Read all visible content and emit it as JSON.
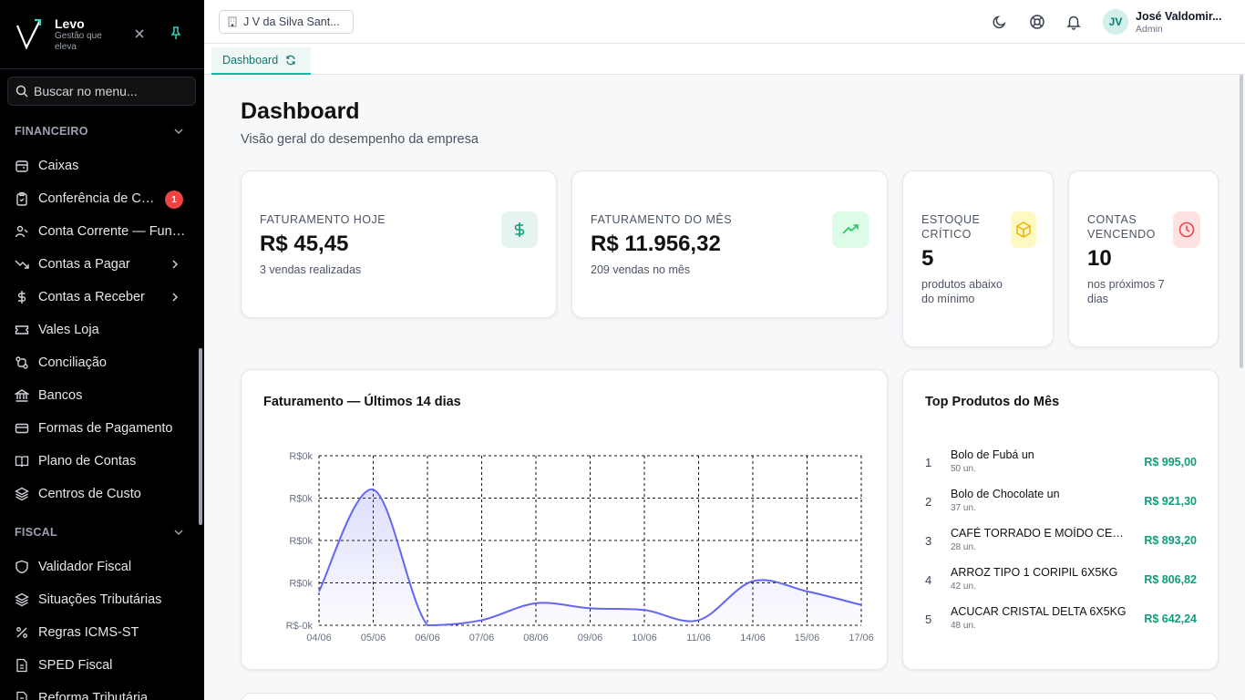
{
  "brand": {
    "name": "Levo",
    "tagline": "Gestão que eleva"
  },
  "sidebar": {
    "search_placeholder": "Buscar no menu...",
    "sections": [
      {
        "title": "FINANCEIRO",
        "items": [
          {
            "label": "Caixas",
            "icon": "cash-register-icon"
          },
          {
            "label": "Conferência de Caixa",
            "icon": "clipboard-icon",
            "badge": "1"
          },
          {
            "label": "Conta Corrente — Funcionários",
            "icon": "users-icon"
          },
          {
            "label": "Contas a Pagar",
            "icon": "trending-down-icon",
            "has_children": true
          },
          {
            "label": "Contas a Receber",
            "icon": "dollar-icon",
            "has_children": true
          },
          {
            "label": "Vales Loja",
            "icon": "ticket-icon"
          },
          {
            "label": "Conciliação",
            "icon": "git-compare-icon"
          },
          {
            "label": "Bancos",
            "icon": "bank-icon"
          },
          {
            "label": "Formas de Pagamento",
            "icon": "credit-card-icon"
          },
          {
            "label": "Plano de Contas",
            "icon": "book-icon"
          },
          {
            "label": "Centros de Custo",
            "icon": "layers-icon"
          }
        ]
      },
      {
        "title": "FISCAL",
        "items": [
          {
            "label": "Validador Fiscal",
            "icon": "shield-check-icon"
          },
          {
            "label": "Situações Tributárias",
            "icon": "layers-icon"
          },
          {
            "label": "Regras ICMS-ST",
            "icon": "percent-icon"
          },
          {
            "label": "SPED Fiscal",
            "icon": "file-icon"
          },
          {
            "label": "Reforma Tributária",
            "icon": "file-icon"
          }
        ]
      }
    ]
  },
  "topbar": {
    "company": "J V da Silva Sant...",
    "user_initials": "JV",
    "user_name": "José Valdomir...",
    "user_role": "Admin"
  },
  "tabs": [
    {
      "label": "Dashboard"
    }
  ],
  "page": {
    "title": "Dashboard",
    "subtitle": "Visão geral do desempenho da empresa"
  },
  "kpis": [
    {
      "label": "FATURAMENTO HOJE",
      "value": "R$ 45,45",
      "desc": "3 vendas realizadas",
      "icon": "dollar-icon",
      "color": "#0f9d7a"
    },
    {
      "label": "FATURAMENTO DO MÊS",
      "value": "R$ 11.956,32",
      "desc": "209 vendas no mês",
      "icon": "trending-up-icon",
      "color": "#22c55e"
    },
    {
      "label": "ESTOQUE CRÍTICO",
      "value": "5",
      "desc": "produtos abaixo do mínimo",
      "icon": "box-icon",
      "color": "#eab308"
    },
    {
      "label": "CONTAS VENCENDO",
      "value": "10",
      "desc": "nos próximos 7 dias",
      "icon": "clock-icon",
      "color": "#ef4444"
    }
  ],
  "chart_title": "Faturamento — Últimos 14 dias",
  "chart_data": {
    "type": "area",
    "x": [
      "04/06",
      "05/06",
      "06/06",
      "07/06",
      "08/06",
      "09/06",
      "10/06",
      "11/06",
      "14/06",
      "15/06",
      "17/06"
    ],
    "values": [
      0.2,
      0.8,
      0.0,
      0.03,
      0.13,
      0.1,
      0.09,
      0.03,
      0.26,
      0.2,
      0.12
    ],
    "ytick_labels": [
      "R$0k",
      "R$0k",
      "R$0k",
      "R$0k",
      "R$-0k"
    ],
    "ylim": [
      0,
      1
    ],
    "grid": true,
    "color": "#6366f1"
  },
  "top_products": {
    "title": "Top Produtos do Mês",
    "items": [
      {
        "rank": "1",
        "name": "Bolo de Fubá un",
        "qty": "50 un.",
        "value": "R$ 995,00"
      },
      {
        "rank": "2",
        "name": "Bolo de Chocolate un",
        "qty": "37 un.",
        "value": "R$ 921,30"
      },
      {
        "rank": "3",
        "name": "CAFÉ TORRADO E MOÍDO CERRADO",
        "qty": "28 un.",
        "value": "R$ 893,20"
      },
      {
        "rank": "4",
        "name": "ARROZ TIPO 1 CORIPIL 6X5KG",
        "qty": "42 un.",
        "value": "R$ 806,82"
      },
      {
        "rank": "5",
        "name": "ACUCAR CRISTAL DELTA 6X5KG",
        "qty": "48 un.",
        "value": "R$ 642,24"
      }
    ]
  }
}
